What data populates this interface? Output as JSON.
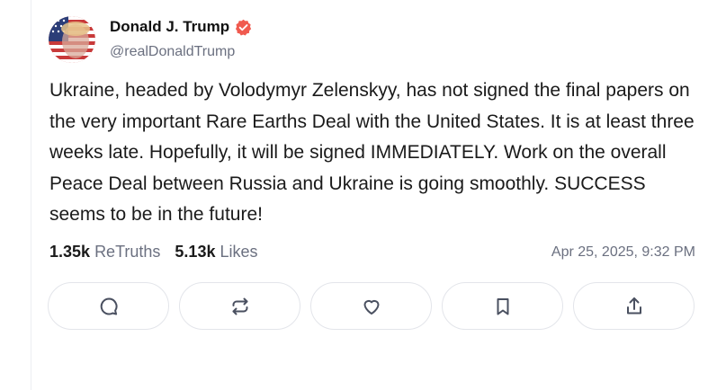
{
  "post": {
    "author_name": "Donald J. Trump",
    "handle": "@realDonaldTrump",
    "text": "Ukraine, headed by Volodymyr Zelenskyy, has not signed the final papers on the very important Rare Earths Deal with the United States. It is at least three weeks late. Hopefully, it will be signed IMMEDIATELY. Work on the overall Peace Deal between Russia and Ukraine is going smoothly. SUCCESS seems to be in the future!",
    "retruths_count": "1.35k",
    "retruths_label": "ReTruths",
    "likes_count": "5.13k",
    "likes_label": "Likes",
    "timestamp": "Apr 25, 2025, 9:32 PM"
  },
  "actions": [
    {
      "icon": "comment-icon"
    },
    {
      "icon": "retruth-icon"
    },
    {
      "icon": "heart-icon"
    },
    {
      "icon": "bookmark-icon"
    },
    {
      "icon": "share-icon"
    }
  ],
  "colors": {
    "verified_badge": "#f05a4f",
    "muted_text": "#6b7080",
    "icon": "#4a5060"
  }
}
